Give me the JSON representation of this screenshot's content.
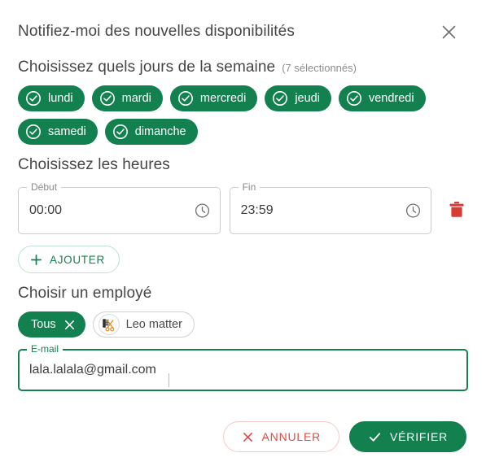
{
  "dialog": {
    "title": "Notifiez-moi des nouvelles disponibilités",
    "close_icon": "close-icon"
  },
  "days_section": {
    "title": "Choisissez quels jours de la semaine",
    "subtitle": "(7 sélectionnés)",
    "chips": [
      {
        "label": "lundi",
        "selected": true
      },
      {
        "label": "mardi",
        "selected": true
      },
      {
        "label": "mercredi",
        "selected": true
      },
      {
        "label": "jeudi",
        "selected": true
      },
      {
        "label": "vendredi",
        "selected": true
      },
      {
        "label": "samedi",
        "selected": true
      },
      {
        "label": "dimanche",
        "selected": true
      }
    ]
  },
  "hours_section": {
    "title": "Choisissez les heures",
    "start": {
      "label": "Début",
      "value": "00:00",
      "icon": "clock-icon"
    },
    "end": {
      "label": "Fin",
      "value": "23:59",
      "icon": "clock-icon"
    },
    "delete_icon": "trash-icon",
    "add_button": {
      "label": "AJOUTER",
      "icon": "plus-icon"
    }
  },
  "employee_section": {
    "title": "Choisir un employé",
    "chips": [
      {
        "label": "Tous",
        "selected": true,
        "icon": "close-icon"
      },
      {
        "label": "Leo matter",
        "selected": false,
        "icon": "barber-avatar-icon"
      }
    ]
  },
  "email_field": {
    "label": "E-mail",
    "value": "lala.lalala@gmail.com",
    "placeholder": "E-mail",
    "focused": true
  },
  "footer": {
    "cancel": {
      "label": "ANNULER",
      "icon": "x-icon"
    },
    "confirm": {
      "label": "VÉRIFIER",
      "icon": "check-icon"
    }
  },
  "colors": {
    "green": "#12804f",
    "red": "#e04a45",
    "trash_red": "#d43c34",
    "text": "#464646",
    "muted": "#8b8b8b",
    "border": "#cccccc"
  }
}
